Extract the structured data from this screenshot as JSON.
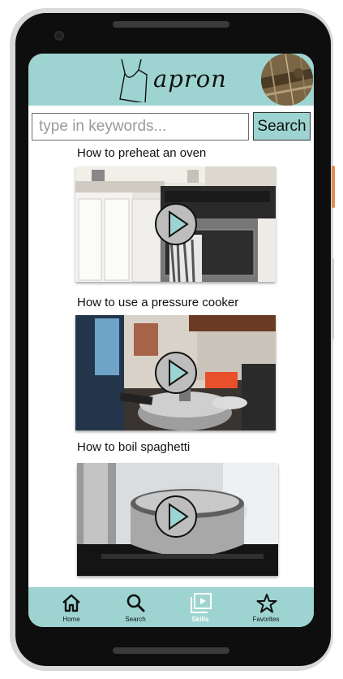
{
  "app": {
    "name": "apron"
  },
  "search": {
    "placeholder": "type in keywords...",
    "button_label": "Search"
  },
  "videos": [
    {
      "title": "How to preheat an oven"
    },
    {
      "title": "How to use a pressure cooker"
    },
    {
      "title": "How to boil spaghetti"
    }
  ],
  "nav": {
    "items": [
      {
        "label": "Home",
        "icon": "home-icon",
        "active": false
      },
      {
        "label": "Search",
        "icon": "search-icon",
        "active": false
      },
      {
        "label": "Skills",
        "icon": "skills-icon",
        "active": true
      },
      {
        "label": "Favorites",
        "icon": "star-icon",
        "active": false
      }
    ]
  },
  "colors": {
    "accent": "#9dd4d1",
    "active_nav_label": "#ffffff"
  }
}
